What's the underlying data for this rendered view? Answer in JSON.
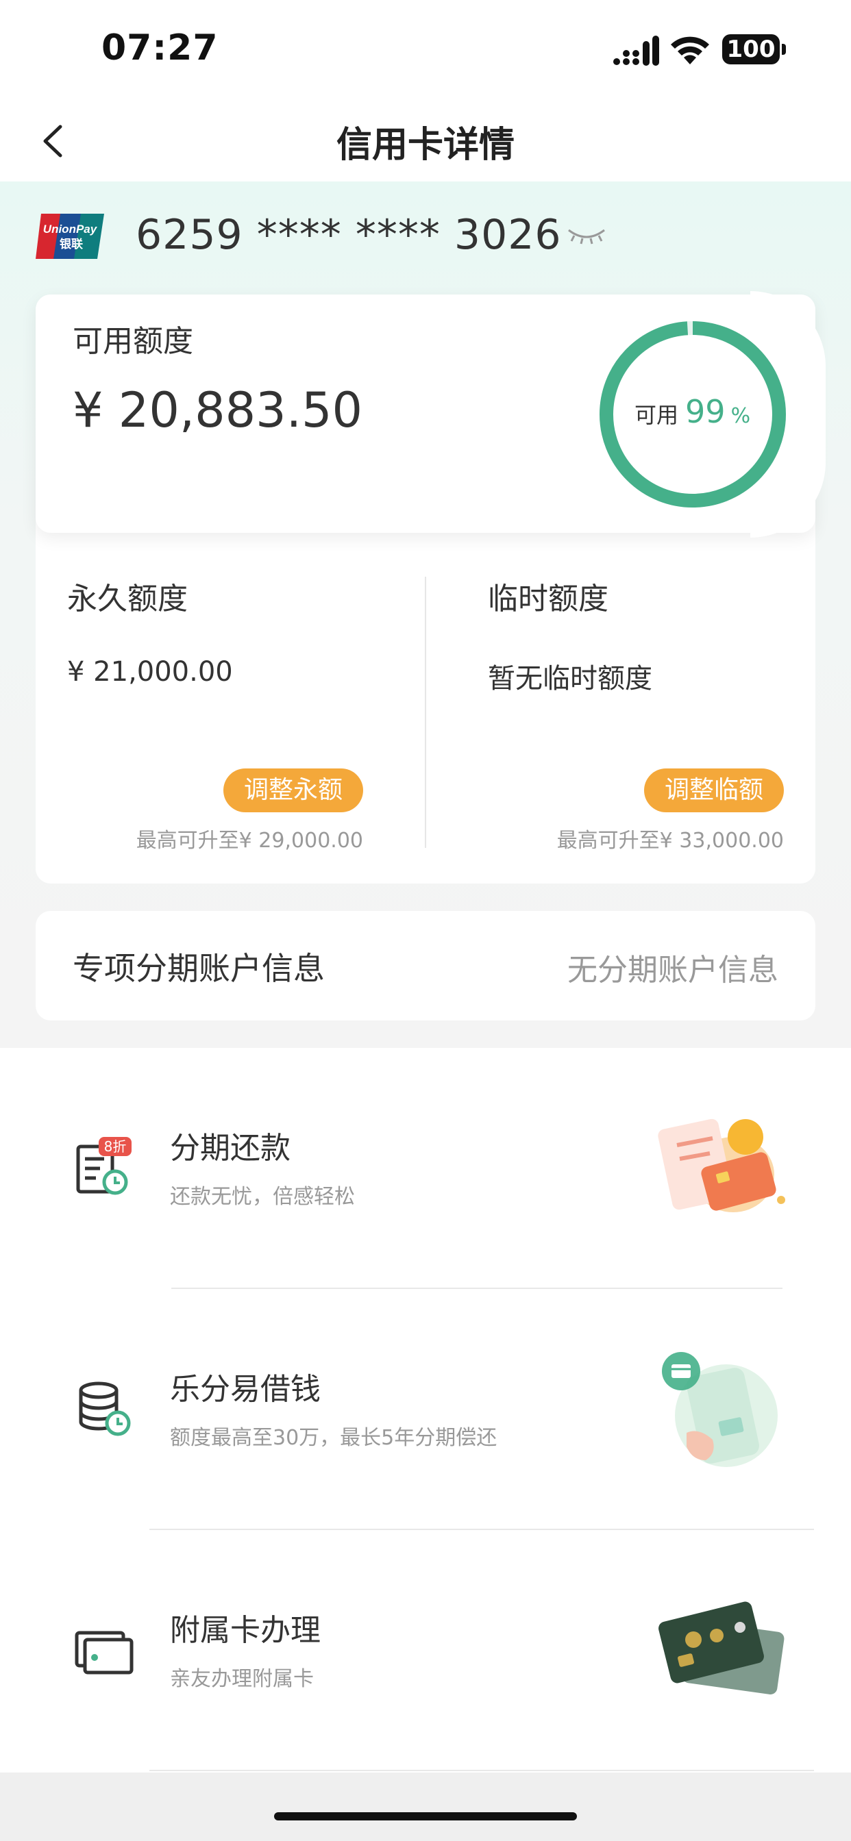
{
  "status_bar": {
    "time": "07:27",
    "battery": "100"
  },
  "nav": {
    "title": "信用卡详情"
  },
  "card": {
    "brand_text": "UnionPay 银联",
    "number": "6259 **** **** 3026"
  },
  "available": {
    "label": "可用额度",
    "amount": "¥ 20,883.50",
    "ring_label": "可用",
    "ring_value": "99",
    "ring_unit": "%",
    "ring_percent": 99,
    "ring_color": "#45b08a"
  },
  "permanent": {
    "title": "永久额度",
    "amount": "¥ 21,000.00",
    "button": "调整永额",
    "max_text": "最高可升至¥ 29,000.00"
  },
  "temporary": {
    "title": "临时额度",
    "amount": "暂无临时额度",
    "button": "调整临额",
    "max_text": "最高可升至¥ 33,000.00"
  },
  "installment_account": {
    "label": "专项分期账户信息",
    "value": "无分期账户信息"
  },
  "services": [
    {
      "title": "分期还款",
      "desc": "还款无忧，倍感轻松",
      "badge": "8折",
      "icon": "installment-repay-icon"
    },
    {
      "title": "乐分易借钱",
      "desc": "额度最高至30万，最长5年分期偿还",
      "icon": "loan-coins-icon"
    },
    {
      "title": "附属卡办理",
      "desc": "亲友办理附属卡",
      "icon": "supplementary-card-icon"
    }
  ],
  "colors": {
    "accent_green": "#45b08a",
    "button_orange": "#f4a83a"
  }
}
